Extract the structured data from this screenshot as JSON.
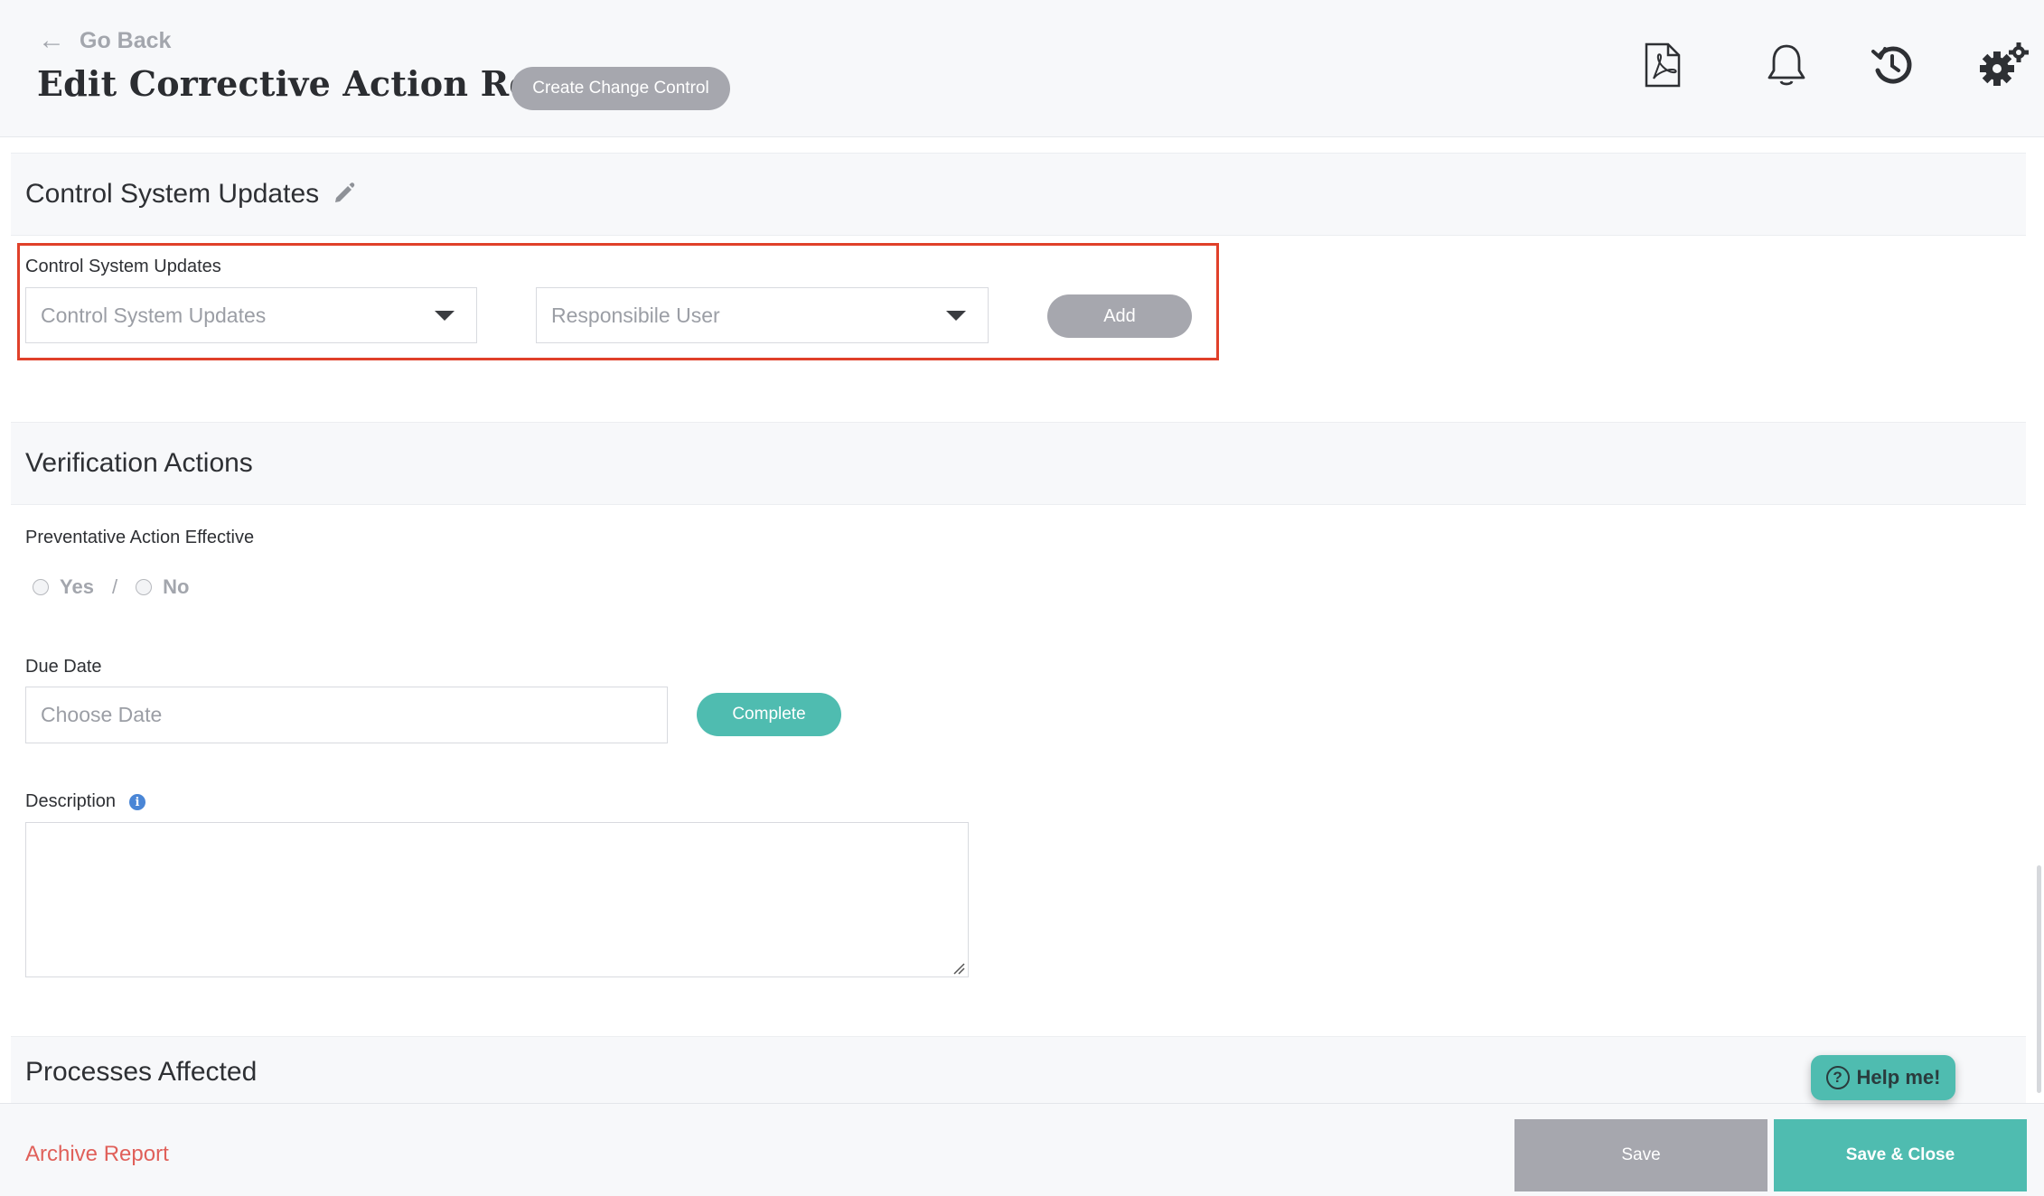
{
  "header": {
    "go_back_label": "Go Back",
    "title": "Edit Corrective Action Report",
    "create_change_control_label": "Create Change Control",
    "icons": [
      "pdf-icon",
      "bell-icon",
      "history-icon",
      "settings-icon"
    ]
  },
  "sections": {
    "control_system": {
      "title": "Control System Updates",
      "field_label": "Control System Updates",
      "select_placeholder": "Control System Updates",
      "user_placeholder": "Responsibile User",
      "add_label": "Add"
    },
    "verification": {
      "title": "Verification Actions",
      "effective_label": "Preventative Action Effective",
      "yes_label": "Yes",
      "separator": "/",
      "no_label": "No",
      "due_date_label": "Due Date",
      "date_placeholder": "Choose Date",
      "complete_label": "Complete",
      "description_label": "Description",
      "description_value": ""
    },
    "processes": {
      "title": "Processes Affected"
    }
  },
  "help": {
    "label": "Help me!"
  },
  "footer": {
    "archive_label": "Archive Report",
    "save_label": "Save",
    "save_close_label": "Save & Close"
  },
  "colors": {
    "accent_teal": "#4fbcb0",
    "disabled_gray": "#a6a7ae",
    "highlight_red": "#e0402a",
    "archive_red": "#e0605a",
    "info_blue": "#4a86d6"
  }
}
